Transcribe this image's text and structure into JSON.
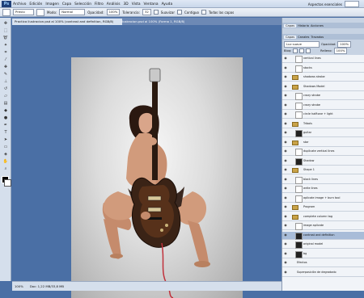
{
  "app": {
    "logo": "Ps"
  },
  "menu": [
    "Archivo",
    "Edición",
    "Imagen",
    "Capa",
    "Selección",
    "Filtro",
    "Análisis",
    "3D",
    "Vista",
    "Ventana",
    "Ayuda"
  ],
  "workspace_label": "Aspectos esenciales",
  "options": {
    "brush_preset": "Previo",
    "mode_label": "Modo:",
    "mode_value": "Normal",
    "opacity_label": "Opacidad:",
    "opacity_value": "100%",
    "tolerance_label": "Tolerancia:",
    "tolerance_value": "32",
    "antialias_label": "Suavizar",
    "contiguous_label": "Contiguo",
    "alllayers_label": "Todas las capas"
  },
  "tabs": [
    {
      "label": "Practica ilustracion.psd al 100% (contrast and definition, RGB/8)",
      "active": true
    },
    {
      "label": "ilustracion.psd al 100% (Forma 1, RGB/8)",
      "active": false
    }
  ],
  "status": {
    "zoom": "100%",
    "doc": "Doc: 1,22 MB/33,8 MB"
  },
  "right_panel": {
    "top_tabs": [
      "Capas",
      "Historia",
      "Acciones"
    ],
    "layers_tabs": [
      "Capas",
      "Canales",
      "Trazados"
    ],
    "blend_mode": "Luz suave",
    "opacity_label": "Opacidad:",
    "opacity_value": "100%",
    "lock_label": "Bloq:",
    "fill_label": "Relleno:",
    "fill_value": "100%"
  },
  "layers": [
    {
      "name": "vertical lines",
      "kind": "layer",
      "visible": true,
      "selected": false
    },
    {
      "name": "stocks",
      "kind": "layer",
      "visible": true,
      "selected": false
    },
    {
      "name": "shadows strobe",
      "kind": "group",
      "visible": true,
      "selected": false
    },
    {
      "name": "Shadows Model",
      "kind": "group",
      "visible": true,
      "selected": false
    },
    {
      "name": "crazy strobe",
      "kind": "layer",
      "visible": true,
      "selected": false
    },
    {
      "name": "crazy strobe",
      "kind": "layer",
      "visible": true,
      "selected": false
    },
    {
      "name": "circle halftone + light",
      "kind": "layer",
      "visible": true,
      "selected": false
    },
    {
      "name": "Tribals",
      "kind": "group",
      "visible": true,
      "selected": false
    },
    {
      "name": "guitar",
      "kind": "layer",
      "visible": true,
      "selected": false
    },
    {
      "name": "star",
      "kind": "group",
      "visible": true,
      "selected": false
    },
    {
      "name": "duplicate vertical lines",
      "kind": "layer",
      "visible": true,
      "selected": false
    },
    {
      "name": "Shadow",
      "kind": "layer",
      "visible": true,
      "selected": false
    },
    {
      "name": "Shape 1",
      "kind": "group",
      "visible": true,
      "selected": false
    },
    {
      "name": "black lines",
      "kind": "layer",
      "visible": true,
      "selected": false
    },
    {
      "name": "write lines",
      "kind": "layer",
      "visible": true,
      "selected": false
    },
    {
      "name": "aplicate image + burn tool",
      "kind": "layer",
      "visible": true,
      "selected": false
    },
    {
      "name": "Program",
      "kind": "group",
      "visible": true,
      "selected": false
    },
    {
      "name": "complete column tag",
      "kind": "group",
      "visible": true,
      "selected": false
    },
    {
      "name": "image aplicate",
      "kind": "layer",
      "visible": true,
      "selected": false
    },
    {
      "name": "contrast and definition",
      "kind": "layer",
      "visible": true,
      "selected": true
    },
    {
      "name": "original model",
      "kind": "layer",
      "visible": true,
      "selected": false
    },
    {
      "name": "bg",
      "kind": "layer",
      "visible": true,
      "selected": false
    },
    {
      "name": "Efectos",
      "kind": "fx",
      "visible": true,
      "selected": false
    },
    {
      "name": "Superposición de degradado",
      "kind": "fx",
      "visible": true,
      "selected": false
    }
  ]
}
